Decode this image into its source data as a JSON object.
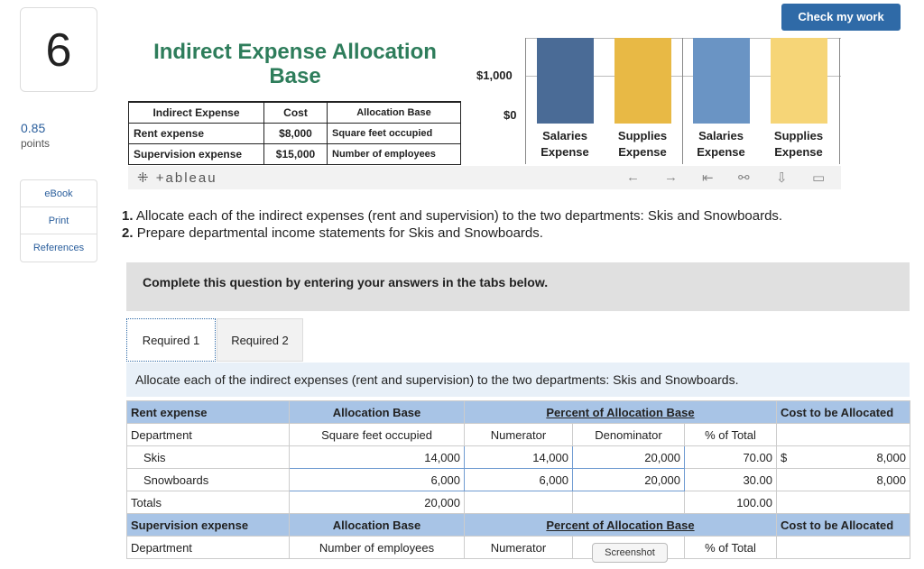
{
  "question": {
    "number": "6",
    "points_value": "0.85",
    "points_label": "points"
  },
  "side_links": [
    "eBook",
    "Print",
    "References"
  ],
  "check_button": "Check my work",
  "viz": {
    "title": "Indirect Expense Allocation Base",
    "table": {
      "headers": [
        "Indirect Expense",
        "Cost",
        "Allocation Base"
      ],
      "rows": [
        [
          "Rent expense",
          "$8,000",
          "Square feet occupied"
        ],
        [
          "Supervision expense",
          "$15,000",
          "Number of employees"
        ]
      ]
    },
    "chart_axis": {
      "tick_high": "$1,000",
      "tick_low": "$0"
    },
    "bar_labels": [
      [
        "Salaries",
        "Expense"
      ],
      [
        "Supplies",
        "Expense"
      ],
      [
        "Salaries",
        "Expense"
      ],
      [
        "Supplies",
        "Expense"
      ]
    ],
    "bar_colors": [
      "#4a6b96",
      "#e8b945",
      "#6a94c4",
      "#f6d577"
    ],
    "tableau_logo": "+ableau"
  },
  "instructions": [
    {
      "num": "1.",
      "text": "Allocate each of the indirect expenses (rent and supervision) to the two departments: Skis and Snowboards."
    },
    {
      "num": "2.",
      "text": "Prepare departmental income statements for Skis and Snowboards."
    }
  ],
  "complete_text": "Complete this question by entering your answers in the tabs below.",
  "tabs": [
    "Required 1",
    "Required 2"
  ],
  "alloc_instruction": "Allocate each of the indirect expenses (rent and supervision) to the two departments: Skis and Snowboards.",
  "grid": {
    "rent_header": [
      "Rent expense",
      "Allocation Base",
      "Percent of Allocation Base",
      "Cost to be Allocated"
    ],
    "sub_header": [
      "Department",
      "Square feet occupied",
      "Numerator",
      "Denominator",
      "% of Total"
    ],
    "rows": [
      {
        "dept": "Skis",
        "base": "14,000",
        "num": "14,000",
        "den": "20,000",
        "pct": "70.00",
        "cur": "$",
        "cost": "8,000"
      },
      {
        "dept": "Snowboards",
        "base": "6,000",
        "num": "6,000",
        "den": "20,000",
        "pct": "30.00",
        "cur": "",
        "cost": "8,000"
      }
    ],
    "totals": {
      "label": "Totals",
      "base": "20,000",
      "pct": "100.00"
    },
    "sup_header": [
      "Supervision expense",
      "Allocation Base",
      "Percent of Allocation Base",
      "Cost to be Allocated"
    ],
    "sup_sub": [
      "Department",
      "Number of employees",
      "Numerator",
      "% of Total"
    ]
  },
  "screenshot_tip": "Screenshot"
}
